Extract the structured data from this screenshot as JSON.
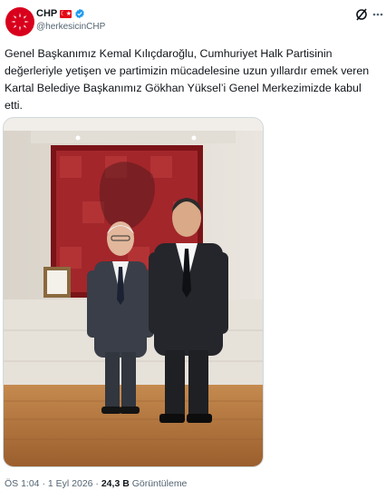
{
  "author": {
    "display_name": "CHP",
    "flag": "☾★",
    "handle": "@herkesicinCHP"
  },
  "tweet": {
    "text": "Genel Başkanımız Kemal Kılıçdaroğlu, Cumhuriyet Halk Partisinin\ndeğerleriyle yetişen ve partimizin mücadelesine uzun yıllardır emek veren\nKartal Belediye Başkanımız Gökhan Yüksel’i Genel Merkezimizde kabul\netti."
  },
  "meta": {
    "time": "ÖS 1:04",
    "separator": "·",
    "date": "1 Eyl 2026",
    "views": "24,3 B",
    "views_label": "Görüntüleme"
  },
  "colors": {
    "brand_red": "#d8001c",
    "verified_blue": "#1d9bf0",
    "muted_text": "#536471"
  },
  "icons": [
    "chp-logo-icon",
    "turkey-flag-icon",
    "verified-badge-icon",
    "grok-icon",
    "more-icon"
  ]
}
